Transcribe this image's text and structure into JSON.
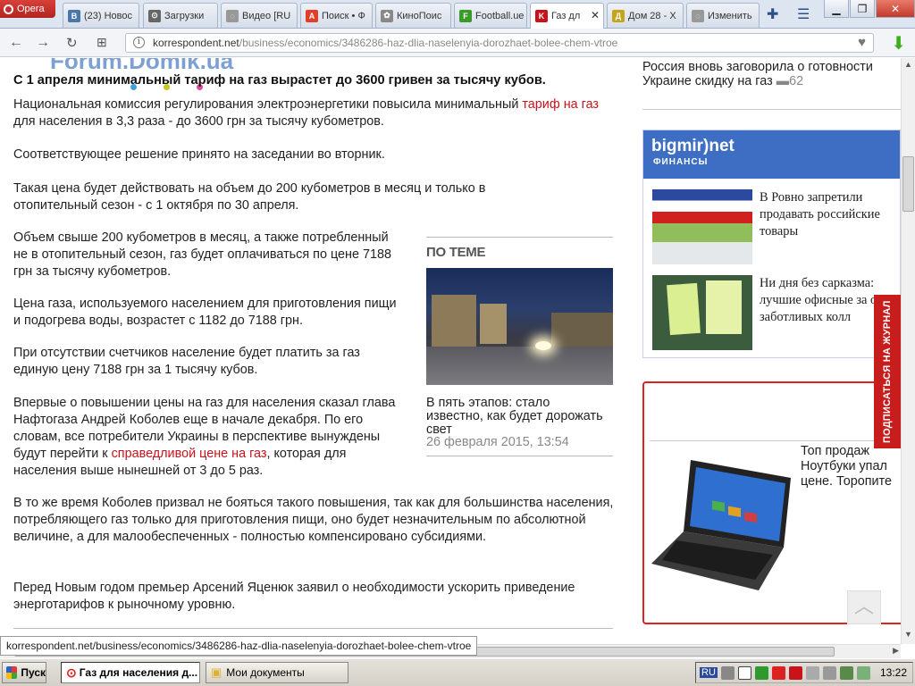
{
  "browser": {
    "menu_label": "Opera",
    "tabs": [
      {
        "label": "(23) Новос",
        "fav": "vk",
        "fav_text": "В",
        "color": "#4a76a8"
      },
      {
        "label": "Загрузки",
        "fav": "download",
        "fav_text": "⊙",
        "color": "#666"
      },
      {
        "label": "Видео [RU",
        "fav": "loading",
        "fav_text": "◌",
        "color": "#999"
      },
      {
        "label": "Поиск • Ф",
        "fav": "search",
        "fav_text": "A",
        "color": "#e0402a"
      },
      {
        "label": "КиноПоис",
        "fav": "film",
        "fav_text": "✿",
        "color": "#888"
      },
      {
        "label": "Football.ue",
        "fav": "football",
        "fav_text": "F",
        "color": "#3a9a2a"
      },
      {
        "label": "Газ дл",
        "fav": "korrespondent",
        "fav_text": "K",
        "color": "#c8131b",
        "active": true
      },
      {
        "label": "Дом 28 - Х",
        "fav": "forum",
        "fav_text": "Д",
        "color": "#c6a41a"
      },
      {
        "label": "Изменить",
        "fav": "loading",
        "fav_text": "◌",
        "color": "#999"
      }
    ],
    "url_domain": "korrespondent.net",
    "url_path": "/business/economics/3486286-haz-dlia-naselenyia-dorozhaet-bolee-chem-vtroe",
    "status_url": "korrespondent.net/business/economics/3486286-haz-dlia-naselenyia-dorozhaet-bolee-chem-vtroe"
  },
  "watermark": "Forum.Domik.ua",
  "article": {
    "title": "С 1 апреля минимальный тариф на газ вырастет до 3600 гривен за тысячу кубов.",
    "p1_a": "Национальная комиссия регулирования электроэнергетики повысила минимальный ",
    "p1_link": "тариф на газ",
    "p1_b": " для населения в 3,3 раза -  до 3600 грн за тысячу кубометров.",
    "p2": "Соответствующее решение принято на заседании во вторник.",
    "p3": "Такая цена будет действовать на объем до 200 кубометров в месяц и только в отопительный сезон - с 1 октября по 30 апреля.",
    "p4": "Объем свыше 200 кубометров в месяц, а также потребленный не в отопительный сезон, газ будет оплачиваться по цене 7188 грн за тысячу кубометров.",
    "p5": "Цена газа, используемого населением для приготовления пищи и подогрева воды, возрастет с 1182 до 7188 грн.",
    "p6": "При отсутствии счетчиков население будет платить за газ единую цену 7188 грн за 1 тысячу кубов.",
    "p7_a": "Впервые о повышении цены на газ для населения сказал глава Нафтогаза Андрей Коболев еще в начале декабря. По его словам, все потребители Украины в перспективе вынуждены будут перейти к ",
    "p7_link": "справедливой цене на газ",
    "p7_b": ", которая для населения выше нынешней от 3 до 5 раз.",
    "p8": "В то же время Коболев призвал не бояться такого повышения, так как для большинства населения, потребляющего газ только для приготовления пищи, оно будет незначительным по абсолютной величине, а для малообеспеченных - полностью компенсировано субсидиями.",
    "p9": "Перед Новым годом премьер Арсений Яценюк заявил о необходимости ускорить приведение энерготарифов к рыночному уровню."
  },
  "related": {
    "label": "ПО ТЕМЕ",
    "caption": "В пять этапов: стало известно, как будет дорожать свет",
    "date": "26 февраля 2015, 13:54"
  },
  "sidebar": {
    "top_text": "Россия вновь заговорила о готовности Украине скидку на газ",
    "top_count": "62",
    "bigmir_title": "bigmir)net",
    "bigmir_sub": "ФИНАНСЫ",
    "items": [
      {
        "text": "В Ровно запретили продавать российские товары"
      },
      {
        "text": "Ни дня без сарказма: лучшие офисные за от заботливых колл"
      }
    ],
    "promo_text_1": "Топ продаж",
    "promo_text_2": "Ноутбуки упал",
    "promo_text_3": "цене. Торопите",
    "subscribe": "ПОДПИСАТЬСЯ НА ЖУРНАЛ"
  },
  "taskbar": {
    "start": "Пуск",
    "tasks": [
      {
        "label": "Газ для населения д..."
      },
      {
        "label": "Мои документы"
      }
    ],
    "lang": "RU",
    "clock": "13:22"
  }
}
